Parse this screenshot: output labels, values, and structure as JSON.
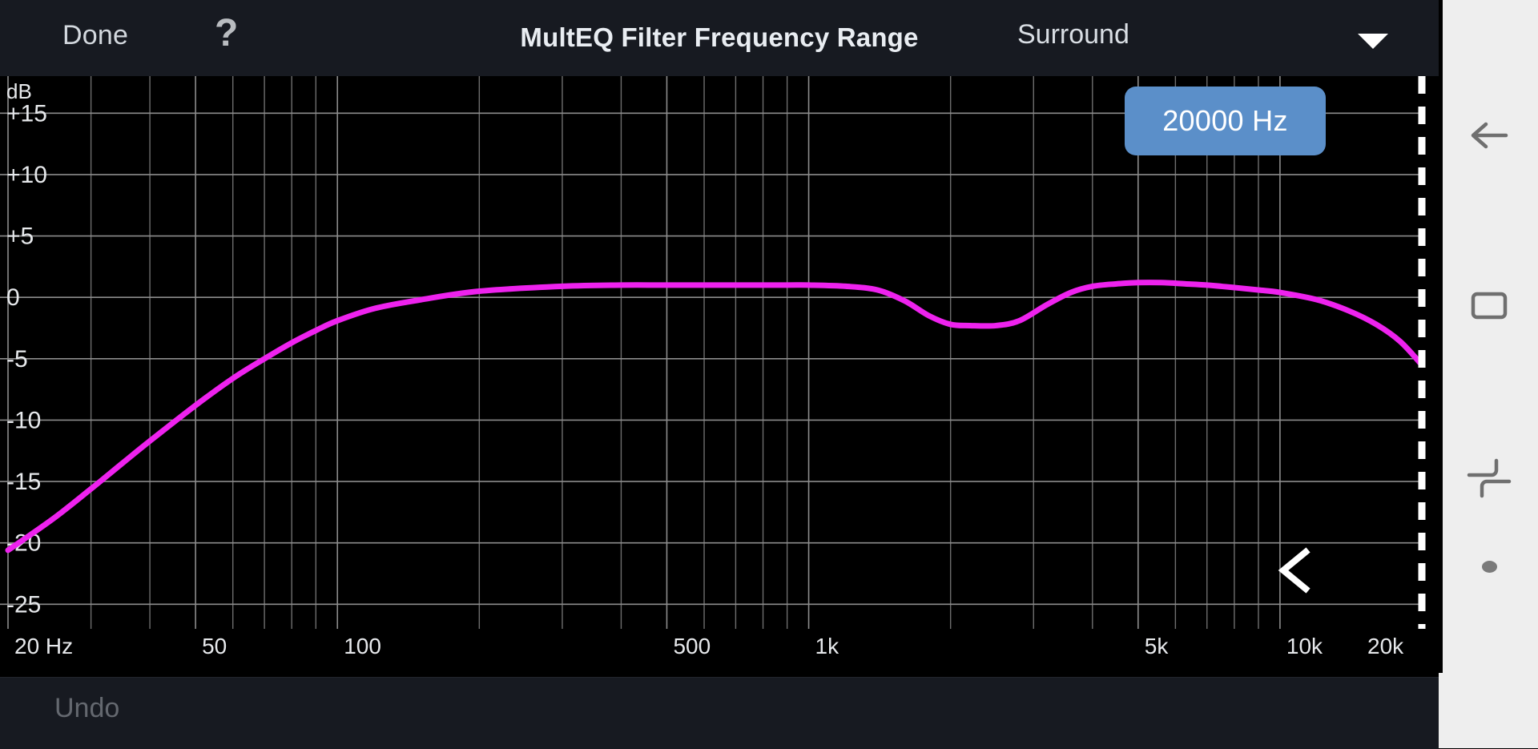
{
  "header": {
    "done_label": "Done",
    "help_icon": "question-mark-icon",
    "title": "MultEQ Filter Frequency Range",
    "channel_label": "Surround",
    "caret_icon": "chevron-down-icon"
  },
  "badge": {
    "value": "20000 Hz",
    "color": "#5b8fc9"
  },
  "footer": {
    "undo_label": "Undo"
  },
  "navbar": {
    "back_icon": "back-arrow-icon",
    "overview_icon": "square-overview-icon",
    "switch_icon": "switch-lines-icon",
    "home_dot_icon": "home-dot-icon"
  },
  "markers": {
    "cursor_line_color": "#ffffff",
    "cursor_line_style": "dashed",
    "chevron_icon": "chevron-left-icon"
  },
  "chart_data": {
    "type": "line",
    "title": "MultEQ Filter Frequency Range",
    "xlabel": "",
    "ylabel": "dB",
    "y_unit_label": "dB",
    "xscale": "log",
    "xlim": [
      20,
      20000
    ],
    "ylim": [
      -27,
      17.5
    ],
    "grid": true,
    "legend": "none",
    "x_ticks": [
      20,
      50,
      100,
      500,
      1000,
      5000,
      10000,
      20000
    ],
    "x_tick_labels": [
      "20 Hz",
      "50",
      "100",
      "500",
      "1k",
      "5k",
      "10k",
      "20k"
    ],
    "y_ticks": [
      15,
      10,
      5,
      0,
      -5,
      -10,
      -15,
      -20,
      -25
    ],
    "y_tick_labels": [
      "+15",
      "+10",
      "+5",
      "0",
      "-5",
      "-10",
      "-15",
      "-20",
      "-25"
    ],
    "x_minor_gridlines": [
      30,
      40,
      60,
      70,
      80,
      90,
      200,
      300,
      400,
      600,
      700,
      800,
      900,
      2000,
      3000,
      4000,
      6000,
      7000,
      8000,
      9000
    ],
    "series": [
      {
        "name": "Surround filter response",
        "color": "#ee22ee",
        "line_width": 7,
        "x": [
          20,
          25,
          30,
          35,
          40,
          50,
          60,
          70,
          80,
          90,
          100,
          120,
          150,
          200,
          300,
          400,
          500,
          700,
          900,
          1000,
          1200,
          1400,
          1600,
          1800,
          2000,
          2200,
          2500,
          2800,
          3200,
          3600,
          4000,
          4500,
          5000,
          5600,
          6300,
          7000,
          8000,
          9000,
          10000,
          12000,
          14000,
          16000,
          18000,
          20000
        ],
        "y": [
          -20.6,
          -18.0,
          -15.6,
          -13.5,
          -11.7,
          -8.8,
          -6.6,
          -5.0,
          -3.7,
          -2.7,
          -1.9,
          -0.9,
          -0.2,
          0.5,
          0.9,
          1.0,
          1.0,
          1.0,
          1.0,
          1.0,
          0.9,
          0.6,
          -0.3,
          -1.5,
          -2.2,
          -2.3,
          -2.3,
          -1.9,
          -0.6,
          0.4,
          0.9,
          1.1,
          1.2,
          1.2,
          1.1,
          1.0,
          0.8,
          0.6,
          0.4,
          -0.2,
          -1.1,
          -2.2,
          -3.6,
          -5.5
        ]
      }
    ],
    "annotations": [
      {
        "type": "vline",
        "x": 20000,
        "label": "20000 Hz",
        "style": "dashed",
        "color": "#ffffff"
      }
    ]
  }
}
